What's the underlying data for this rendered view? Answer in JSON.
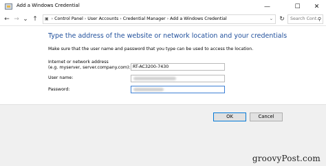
{
  "window": {
    "title": "Add a Windows Credential",
    "minimize_glyph": "—",
    "maximize_glyph": "☐",
    "close_glyph": "✕"
  },
  "nav": {
    "back_glyph": "←",
    "forward_glyph": "→",
    "recent_glyph": "⌄",
    "up_glyph": "↑",
    "refresh_glyph": "↻",
    "breadcrumbs": [
      "Control Panel",
      "User Accounts",
      "Credential Manager",
      "Add a Windows Credential"
    ],
    "search_placeholder": "Search Cont...",
    "search_icon": "search-icon"
  },
  "content": {
    "heading": "Type the address of the website or network location and your credentials",
    "description": "Make sure that the user name and password that you type can be used to access the location.",
    "address_label_line1": "Internet or network address",
    "address_label_line2": "(e.g. myserver, server.company.com):",
    "address_value": "RT-AC3200-7430",
    "username_label": "User name:",
    "password_label": "Password:"
  },
  "footer": {
    "ok_label": "OK",
    "cancel_label": "Cancel"
  },
  "watermark": "groovyPost.com",
  "colors": {
    "heading": "#1e4e9b",
    "focus_border": "#3c7fd4",
    "footer_bg": "#f0f0f0"
  }
}
